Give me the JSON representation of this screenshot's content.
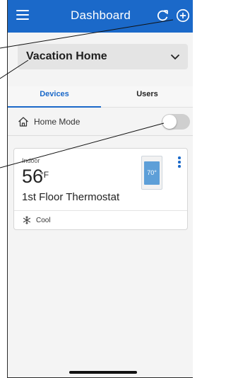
{
  "header": {
    "title": "Dashboard",
    "icons": [
      "menu-icon",
      "refresh-icon",
      "add-icon"
    ]
  },
  "location": {
    "selected": "Vacation Home"
  },
  "tabs": [
    {
      "label": "Devices",
      "active": true
    },
    {
      "label": "Users",
      "active": false
    }
  ],
  "home_mode": {
    "label": "Home Mode",
    "enabled": false
  },
  "device": {
    "indoor_label": "Indoor",
    "temperature": "56",
    "unit": "°F",
    "name": "1st Floor Thermostat",
    "display_reading": "70°",
    "mode": "Cool"
  },
  "colors": {
    "brand": "#1b69c9",
    "background": "#f4f4f4",
    "card": "#ffffff"
  }
}
